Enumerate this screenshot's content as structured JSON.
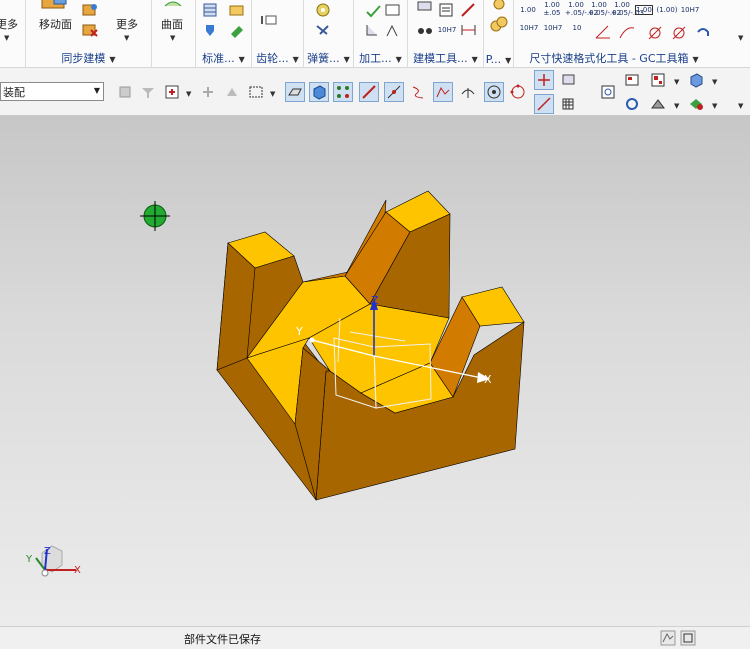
{
  "ribbon": {
    "more_left_label": "更多",
    "move_face_label": "移动面",
    "more_label": "更多",
    "surface_label": "曲面",
    "sync_modeling_group": "同步建模",
    "standard_group": "标准...",
    "gear_group": "齿轮...",
    "spring_group": "弹簧...",
    "machining_group": "加工...",
    "modeling_tools_group": "建模工具...",
    "p_group": "P...",
    "gc_group": "尺寸快速格式化工具 - GC工具箱",
    "tolerance_h7_label": "10H7",
    "dim_values": [
      "1.00",
      "1.00",
      "1.00",
      "1.00",
      "1.00",
      "(1.00)",
      "10H7"
    ],
    "dim_sub_values": [
      "",
      "±.05",
      "+.05/-.02",
      "+.05/-.02",
      "+.05/-.03",
      "",
      ""
    ],
    "fit_values": [
      "10H7",
      "10H7",
      "10"
    ]
  },
  "toolbar2": {
    "filter_value": "装配"
  },
  "viewport": {
    "axis_x": "X",
    "axis_y": "Y",
    "axis_z": "Z",
    "triad_x": "X",
    "triad_y": "Y",
    "triad_z": "Z"
  },
  "status": {
    "message": "部件文件已保存"
  },
  "colors": {
    "part_top": "#ffc400",
    "part_front": "#a86600",
    "part_side": "#d17c00",
    "datum_line": "#f0f0f0",
    "z_axis": "#2233cc"
  }
}
